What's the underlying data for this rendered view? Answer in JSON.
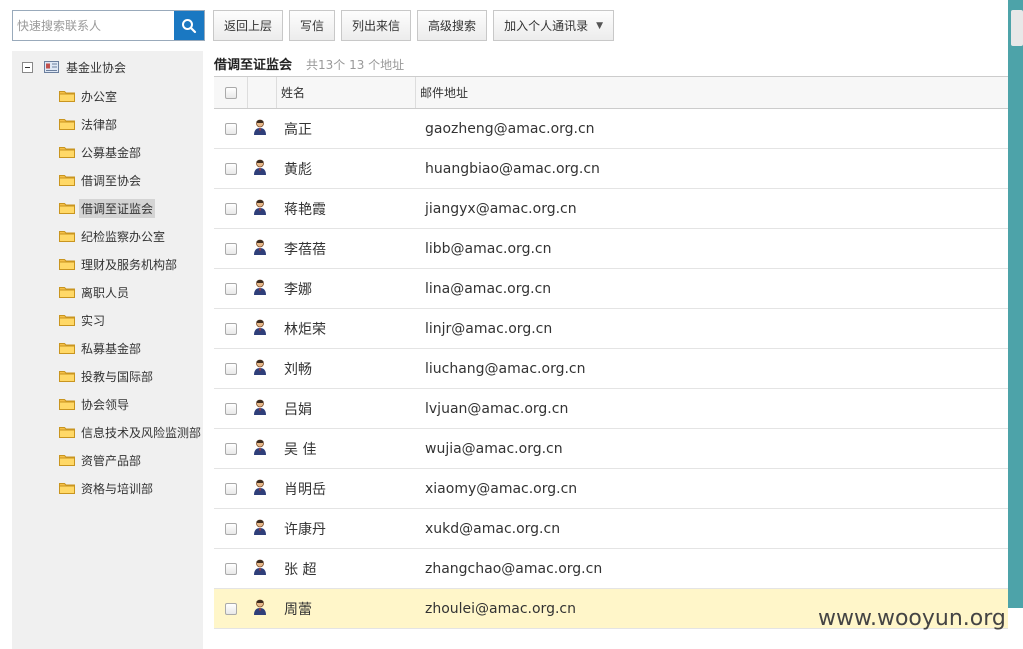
{
  "search": {
    "placeholder": "快速搜索联系人"
  },
  "toolbar": {
    "back": "返回上层",
    "compose": "写信",
    "list_incoming": "列出来信",
    "advanced_search": "高级搜索",
    "add_to_contacts": "加入个人通讯录"
  },
  "tree": {
    "root": "基金业协会",
    "items": [
      {
        "label": "办公室"
      },
      {
        "label": "法律部"
      },
      {
        "label": "公募基金部"
      },
      {
        "label": "借调至协会"
      },
      {
        "label": "借调至证监会"
      },
      {
        "label": "纪检监察办公室"
      },
      {
        "label": "理财及服务机构部"
      },
      {
        "label": "离职人员"
      },
      {
        "label": "实习"
      },
      {
        "label": "私募基金部"
      },
      {
        "label": "投教与国际部"
      },
      {
        "label": "协会领导"
      },
      {
        "label": "信息技术及风险监测部"
      },
      {
        "label": "资管产品部"
      },
      {
        "label": "资格与培训部"
      }
    ],
    "selected_index": 4
  },
  "content": {
    "title": "借调至证监会",
    "count": "共13个 13 个地址"
  },
  "table": {
    "columns": {
      "name": "姓名",
      "email": "邮件地址"
    },
    "rows": [
      {
        "name": "高正",
        "email": "gaozheng@amac.org.cn"
      },
      {
        "name": "黄彪",
        "email": "huangbiao@amac.org.cn"
      },
      {
        "name": "蒋艳霞",
        "email": "jiangyx@amac.org.cn"
      },
      {
        "name": "李蓓蓓",
        "email": "libb@amac.org.cn"
      },
      {
        "name": "李娜",
        "email": "lina@amac.org.cn"
      },
      {
        "name": "林炬荣",
        "email": "linjr@amac.org.cn"
      },
      {
        "name": "刘畅",
        "email": "liuchang@amac.org.cn"
      },
      {
        "name": "吕娟",
        "email": "lvjuan@amac.org.cn"
      },
      {
        "name": "吴 佳",
        "email": "wujia@amac.org.cn"
      },
      {
        "name": "肖明岳",
        "email": "xiaomy@amac.org.cn"
      },
      {
        "name": "许康丹",
        "email": "xukd@amac.org.cn"
      },
      {
        "name": "张 超",
        "email": "zhangchao@amac.org.cn"
      },
      {
        "name": "周蕾",
        "email": "zhoulei@amac.org.cn"
      }
    ],
    "highlighted_index": 12
  },
  "watermark": "www.wooyun.org",
  "colors": {
    "accent": "#1a78c2",
    "highlight_row": "#fff6c9",
    "right_strip": "#4da3a9"
  }
}
